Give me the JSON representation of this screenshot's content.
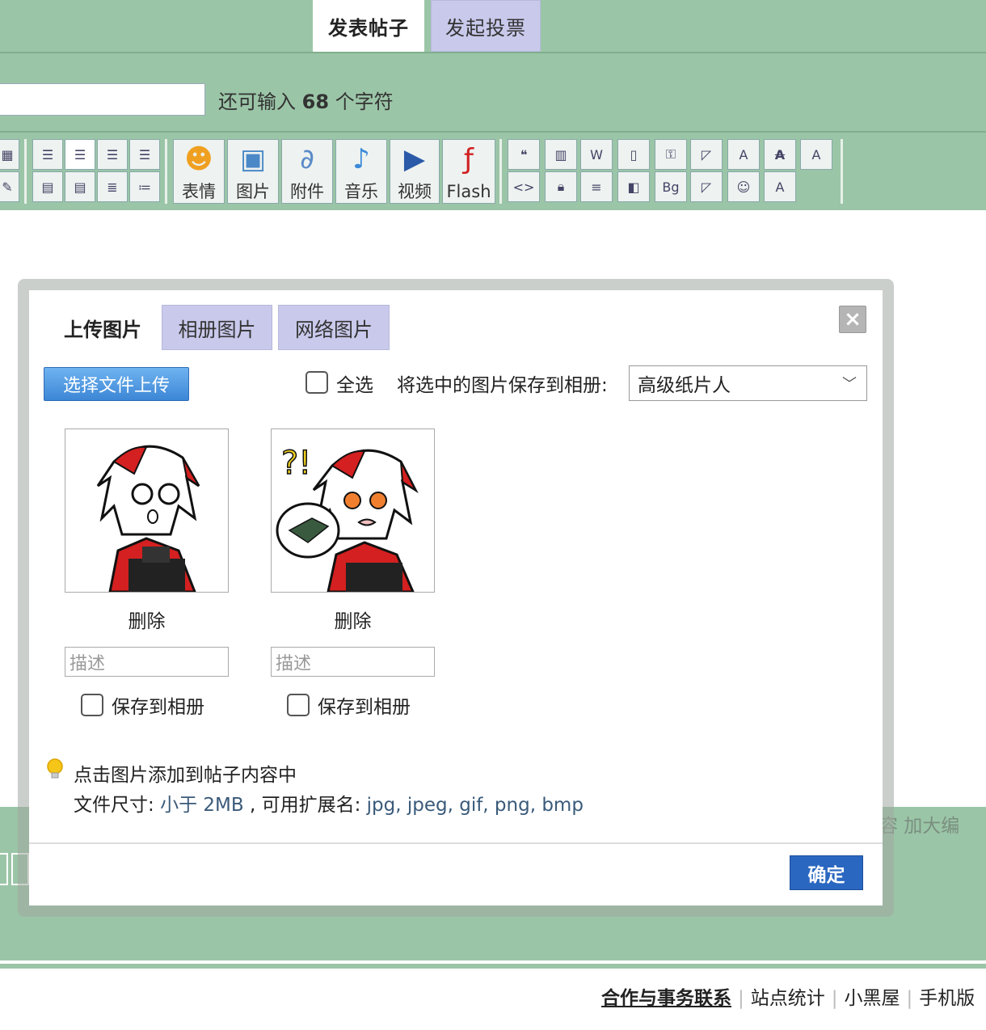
{
  "editor": {
    "tabs": [
      {
        "label": "发表帖子"
      },
      {
        "label": "发起投票"
      }
    ],
    "char_count": {
      "prefix": "还可输入",
      "count": "68",
      "suffix": "个字符"
    },
    "toolbar_buttons": [
      {
        "label": "表情",
        "icon": "smiley-icon"
      },
      {
        "label": "图片",
        "icon": "image-icon"
      },
      {
        "label": "附件",
        "icon": "paperclip-icon"
      },
      {
        "label": "音乐",
        "icon": "music-note-icon"
      },
      {
        "label": "视频",
        "icon": "clapperboard-icon"
      },
      {
        "label": "Flash",
        "icon": "flash-icon"
      }
    ],
    "bottom_right_text": "容  加大编"
  },
  "dialog": {
    "tabs": [
      {
        "label": "上传图片"
      },
      {
        "label": "相册图片"
      },
      {
        "label": "网络图片"
      }
    ],
    "close_icon": "×",
    "upload_button": "选择文件上传",
    "select_all_label": "全选",
    "save_to_album_label": "将选中的图片保存到相册:",
    "album_selected": "高级纸片人",
    "images": [
      {
        "delete_label": "删除",
        "description_placeholder": "描述",
        "save_label": "保存到相册"
      },
      {
        "delete_label": "删除",
        "description_placeholder": "描述",
        "save_label": "保存到相册"
      }
    ],
    "tip_line1": "点击图片添加到帖子内容中",
    "tip_size_prefix": "文件尺寸:",
    "tip_size_value": "小于 2MB",
    "tip_ext_prefix": ", 可用扩展名:",
    "tip_ext_value": "jpg, jpeg, gif, png, bmp",
    "confirm_button": "确定"
  },
  "footer": {
    "links": [
      "合作与事务联系",
      "站点统计",
      "小黑屋",
      "手机版"
    ]
  },
  "colors": {
    "editor_green": "#9bc5a7",
    "tab_lilac": "#c9c9ec",
    "confirm_blue": "#2a67c0",
    "upload_blue": "#3c86d6"
  }
}
